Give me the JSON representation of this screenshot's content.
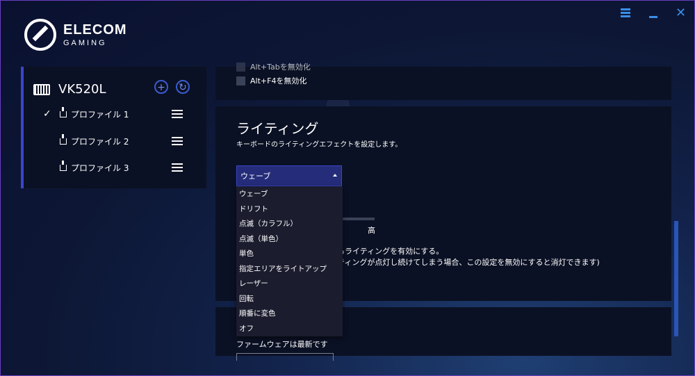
{
  "brand": {
    "line1": "ELECOM",
    "line2": "GAMING"
  },
  "window": {
    "menu_icon": "hamburger-icon",
    "minimize_icon": "minimize-icon",
    "close_icon": "close-icon",
    "close_glyph": "✕"
  },
  "sidebar": {
    "device_name": "VK520L",
    "add_glyph": "+",
    "sync_glyph": "↻",
    "profiles": [
      {
        "label": "プロファイル 1",
        "checked": true
      },
      {
        "label": "プロファイル 2",
        "checked": false
      },
      {
        "label": "プロファイル 3",
        "checked": false
      }
    ],
    "check_glyph": "✓"
  },
  "top_panel": {
    "partial_option": "Alt+Tabを無効化",
    "option": "Alt+F4を無効化"
  },
  "lighting": {
    "title": "ライティング",
    "description": "キーボードのライティングエフェクトを設定します。",
    "selected_effect": "ウェーブ",
    "options": [
      "ウェーブ",
      "ドリフト",
      "点滅（カラフル）",
      "点滅（単色）",
      "単色",
      "指定エリアをライトアップ",
      "レーザー",
      "回転",
      "順番に変色",
      "オフ"
    ],
    "speed_high_label": "高",
    "note_line1": "もライティングを有効にする。",
    "note_line2": "ティングが点灯し続けてしまう場合、この設定を無効にすると消灯できます)"
  },
  "firmware": {
    "status": "ファームウェアは最新です"
  },
  "colors": {
    "accent": "#3a46c8",
    "panel": "#0b1124",
    "dropdown": "#1b1c2e"
  }
}
